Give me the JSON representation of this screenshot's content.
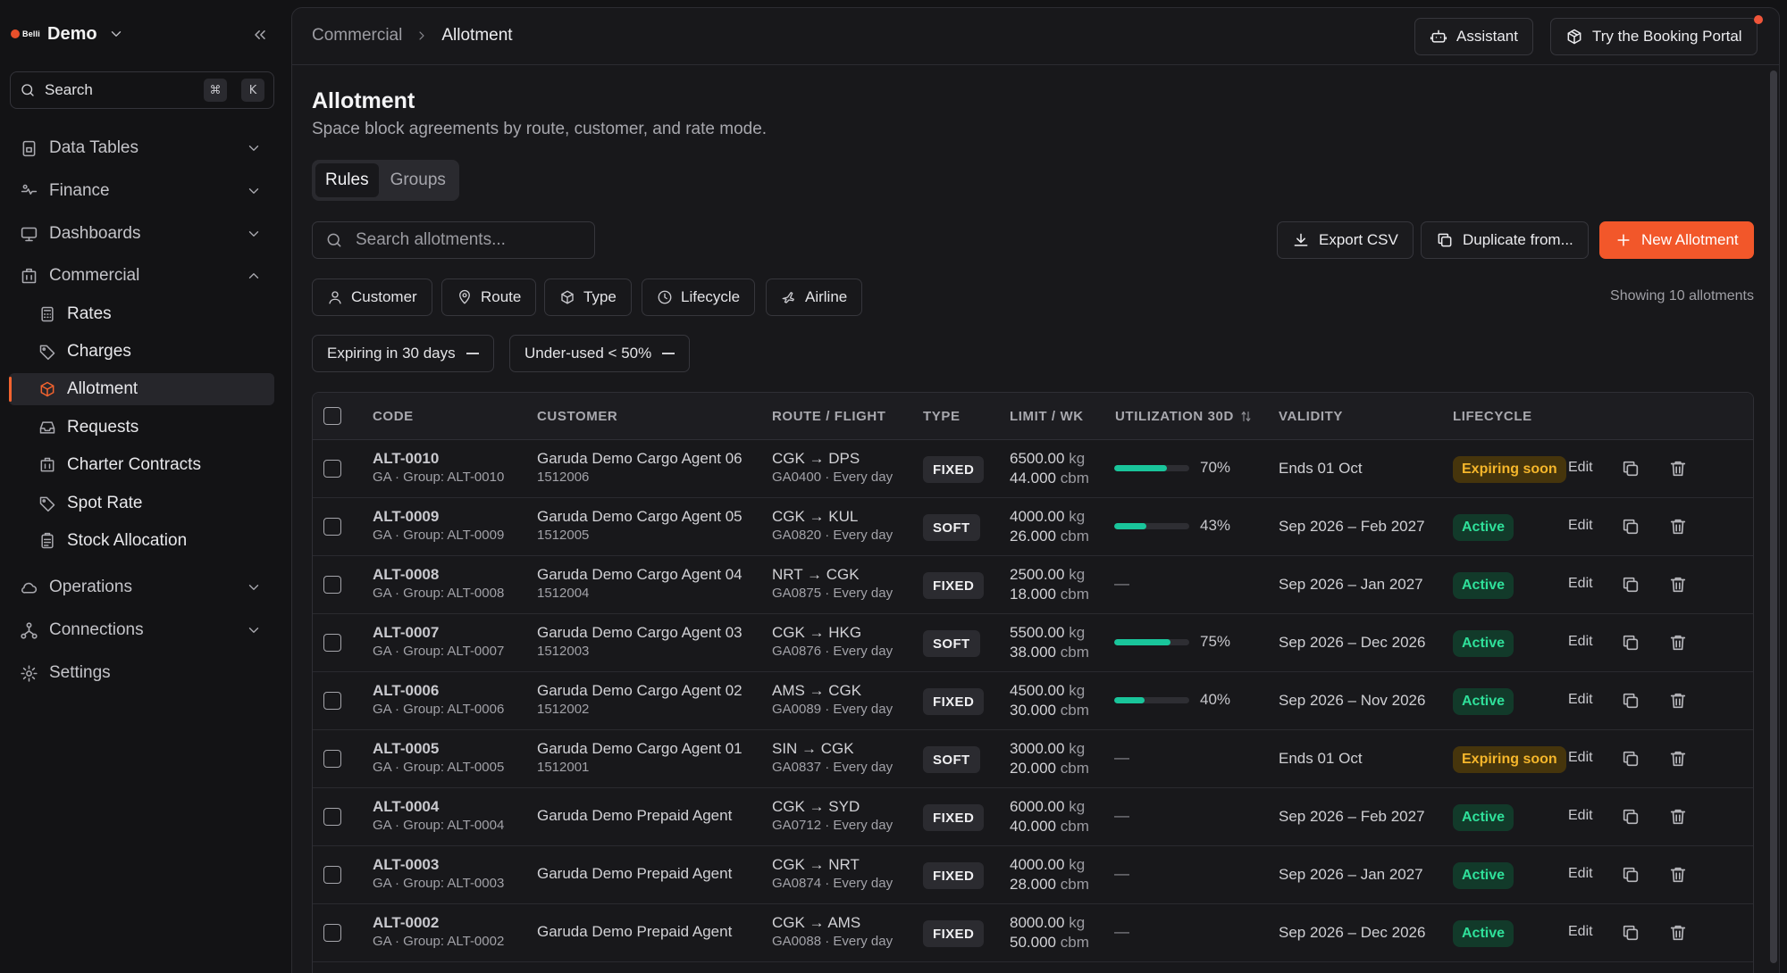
{
  "app": {
    "brand_logo": "Belli",
    "brand_name": "Demo",
    "search_label": "Search",
    "search_keys": [
      "⌘",
      "K"
    ]
  },
  "sidebar": {
    "sections": [
      {
        "label": "Data Tables",
        "icon": "data-tables-icon",
        "expanded": false
      },
      {
        "label": "Finance",
        "icon": "finance-icon",
        "expanded": false
      },
      {
        "label": "Dashboards",
        "icon": "monitor-icon",
        "expanded": false
      },
      {
        "label": "Commercial",
        "icon": "building-icon",
        "expanded": true
      },
      {
        "label": "Operations",
        "icon": "cloud-icon",
        "expanded": false
      },
      {
        "label": "Connections",
        "icon": "connections-icon",
        "expanded": false
      },
      {
        "label": "Settings",
        "icon": "gear-icon",
        "expanded": false
      }
    ],
    "commercial_items": [
      {
        "label": "Rates",
        "icon": "calculator-icon"
      },
      {
        "label": "Charges",
        "icon": "tag-icon"
      },
      {
        "label": "Allotment",
        "icon": "box-icon",
        "active": true
      },
      {
        "label": "Requests",
        "icon": "inbox-icon"
      },
      {
        "label": "Charter Contracts",
        "icon": "building-icon"
      },
      {
        "label": "Spot Rate",
        "icon": "tag-icon"
      },
      {
        "label": "Stock Allocation",
        "icon": "clipboard-icon"
      }
    ]
  },
  "header": {
    "breadcrumb": [
      "Commercial",
      "Allotment"
    ],
    "assistant_label": "Assistant",
    "portal_label": "Try the Booking Portal"
  },
  "page": {
    "title": "Allotment",
    "subtitle": "Space block agreements by route, customer, and rate mode.",
    "tabs": [
      "Rules",
      "Groups"
    ],
    "active_tab": "Rules",
    "search_placeholder": "Search allotments...",
    "export_label": "Export CSV",
    "duplicate_label": "Duplicate from...",
    "new_label": "New Allotment",
    "filters": [
      "Customer",
      "Route",
      "Type",
      "Lifecycle",
      "Airline"
    ],
    "quick_filters": [
      "Expiring in 30 days",
      "Under-used < 50%"
    ],
    "showing_text": "Showing 10 allotments"
  },
  "table": {
    "columns": [
      "CODE",
      "CUSTOMER",
      "ROUTE / FLIGHT",
      "TYPE",
      "LIMIT / WK",
      "UTILIZATION 30D",
      "VALIDITY",
      "LIFECYCLE"
    ],
    "edit_label": "Edit",
    "rows": [
      {
        "code": "ALT-0010",
        "group": "GA · Group: ALT-0010",
        "customer": "Garuda Demo Cargo Agent 06",
        "cust_id": "1512006",
        "route": "CGK → DPS",
        "flight": "GA0400 · Every day",
        "type": "FIXED",
        "kg": "6500.00",
        "cbm": "44.000",
        "util": 70,
        "util_text": "70%",
        "validity": "Ends 01 Oct",
        "lifecycle": "Expiring soon"
      },
      {
        "code": "ALT-0009",
        "group": "GA · Group: ALT-0009",
        "customer": "Garuda Demo Cargo Agent 05",
        "cust_id": "1512005",
        "route": "CGK → KUL",
        "flight": "GA0820 · Every day",
        "type": "SOFT",
        "kg": "4000.00",
        "cbm": "26.000",
        "util": 43,
        "util_text": "43%",
        "validity": "Sep 2026 – Feb 2027",
        "lifecycle": "Active"
      },
      {
        "code": "ALT-0008",
        "group": "GA · Group: ALT-0008",
        "customer": "Garuda Demo Cargo Agent 04",
        "cust_id": "1512004",
        "route": "NRT → CGK",
        "flight": "GA0875 · Every day",
        "type": "FIXED",
        "kg": "2500.00",
        "cbm": "18.000",
        "util": null,
        "util_text": "—",
        "validity": "Sep 2026 – Jan 2027",
        "lifecycle": "Active"
      },
      {
        "code": "ALT-0007",
        "group": "GA · Group: ALT-0007",
        "customer": "Garuda Demo Cargo Agent 03",
        "cust_id": "1512003",
        "route": "CGK → HKG",
        "flight": "GA0876 · Every day",
        "type": "SOFT",
        "kg": "5500.00",
        "cbm": "38.000",
        "util": 75,
        "util_text": "75%",
        "validity": "Sep 2026 – Dec 2026",
        "lifecycle": "Active"
      },
      {
        "code": "ALT-0006",
        "group": "GA · Group: ALT-0006",
        "customer": "Garuda Demo Cargo Agent 02",
        "cust_id": "1512002",
        "route": "AMS → CGK",
        "flight": "GA0089 · Every day",
        "type": "FIXED",
        "kg": "4500.00",
        "cbm": "30.000",
        "util": 40,
        "util_text": "40%",
        "validity": "Sep 2026 – Nov 2026",
        "lifecycle": "Active"
      },
      {
        "code": "ALT-0005",
        "group": "GA · Group: ALT-0005",
        "customer": "Garuda Demo Cargo Agent 01",
        "cust_id": "1512001",
        "route": "SIN → CGK",
        "flight": "GA0837 · Every day",
        "type": "SOFT",
        "kg": "3000.00",
        "cbm": "20.000",
        "util": null,
        "util_text": "—",
        "validity": "Ends 01 Oct",
        "lifecycle": "Expiring soon"
      },
      {
        "code": "ALT-0004",
        "group": "GA · Group: ALT-0004",
        "customer": "Garuda Demo Prepaid Agent",
        "cust_id": "",
        "route": "CGK → SYD",
        "flight": "GA0712 · Every day",
        "type": "FIXED",
        "kg": "6000.00",
        "cbm": "40.000",
        "util": null,
        "util_text": "—",
        "validity": "Sep 2026 – Feb 2027",
        "lifecycle": "Active"
      },
      {
        "code": "ALT-0003",
        "group": "GA · Group: ALT-0003",
        "customer": "Garuda Demo Prepaid Agent",
        "cust_id": "",
        "route": "CGK → NRT",
        "flight": "GA0874 · Every day",
        "type": "FIXED",
        "kg": "4000.00",
        "cbm": "28.000",
        "util": null,
        "util_text": "—",
        "validity": "Sep 2026 – Jan 2027",
        "lifecycle": "Active"
      },
      {
        "code": "ALT-0002",
        "group": "GA · Group: ALT-0002",
        "customer": "Garuda Demo Prepaid Agent",
        "cust_id": "",
        "route": "CGK → AMS",
        "flight": "GA0088 · Every day",
        "type": "FIXED",
        "kg": "8000.00",
        "cbm": "50.000",
        "util": null,
        "util_text": "—",
        "validity": "Sep 2026 – Dec 2026",
        "lifecycle": "Active"
      }
    ],
    "units": {
      "kg": "kg",
      "cbm": "cbm"
    }
  },
  "colors": {
    "accent": "#f2572a",
    "active_status": "#2fe09a",
    "expiring_status": "#f5b62b",
    "progress": "#19c59b"
  }
}
